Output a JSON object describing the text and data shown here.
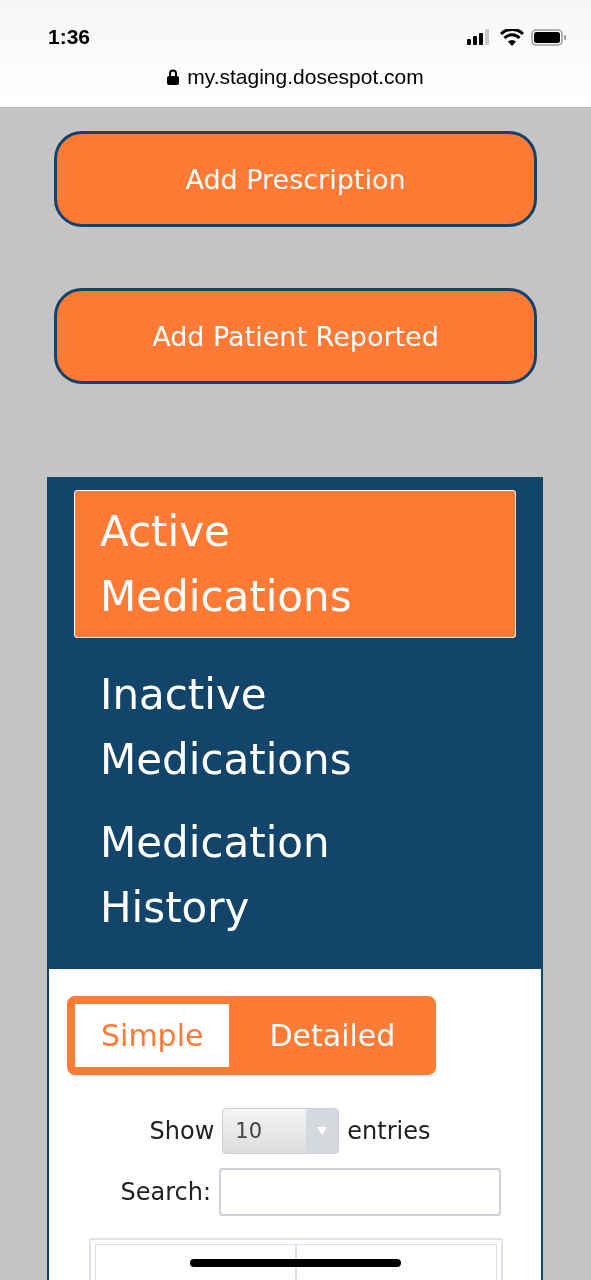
{
  "status_bar": {
    "time": "1:36"
  },
  "address_bar": {
    "url": "my.staging.dosespot.com"
  },
  "actions": [
    "Add Prescription",
    "Add Patient Reported"
  ],
  "tabs": [
    {
      "label": "Active Medications",
      "selected": true
    },
    {
      "label": "Inactive Medications",
      "selected": false
    },
    {
      "label": "Medication History",
      "selected": false
    }
  ],
  "view_toggle": [
    {
      "label": "Simple",
      "selected": true
    },
    {
      "label": "Detailed",
      "selected": false
    }
  ],
  "length_control": {
    "prefix": "Show",
    "value": "10",
    "suffix": "entries"
  },
  "search": {
    "label": "Search:"
  }
}
